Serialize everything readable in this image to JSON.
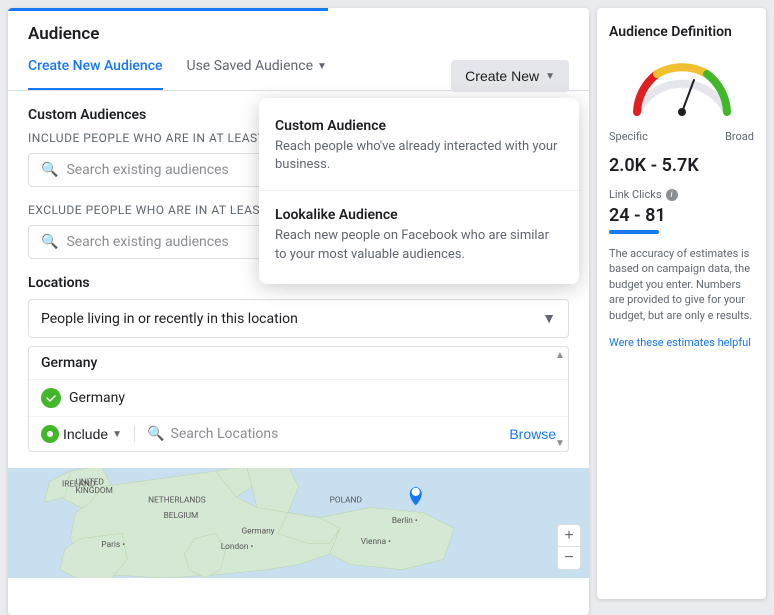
{
  "page": {
    "title": "Audience"
  },
  "tabs": {
    "active": "Create New Audience",
    "items": [
      {
        "label": "Create New Audience",
        "active": true
      },
      {
        "label": "Use Saved Audience",
        "active": false
      }
    ]
  },
  "customAudiences": {
    "label": "Custom Audiences",
    "includeText": "INCLUDE people who are in at least ONE of the following",
    "excludeText": "EXCLUDE people who are in at least ONE of the following",
    "searchPlaceholder": "Search existing audiences"
  },
  "createNewButton": {
    "label": "Create New"
  },
  "dropdownMenu": {
    "items": [
      {
        "title": "Custom Audience",
        "description": "Reach people who've already interacted with your business."
      },
      {
        "title": "Lookalike Audience",
        "description": "Reach new people on Facebook who are similar to your most valuable audiences."
      }
    ]
  },
  "locations": {
    "label": "Locations",
    "selectValue": "People living in or recently in this location",
    "country": "Germany",
    "locationItem": "Germany",
    "includeLabel": "Include",
    "searchPlaceholder": "Search Locations",
    "browseLabel": "Browse"
  },
  "audienceDefinition": {
    "title": "Audience Definition",
    "gaugeLeft": "Specific",
    "gaugeRight": "Broad",
    "sizeRange": "2.0K - 5.7K",
    "linkClicksLabel": "Link Clicks",
    "linkClicksRange": "24 - 81",
    "accuracyText": "The accuracy of estimates is based on campaign data, the budget you enter. Numbers are provided to give for your budget, but are only e results.",
    "helpfulLink": "Were these estimates helpful"
  }
}
